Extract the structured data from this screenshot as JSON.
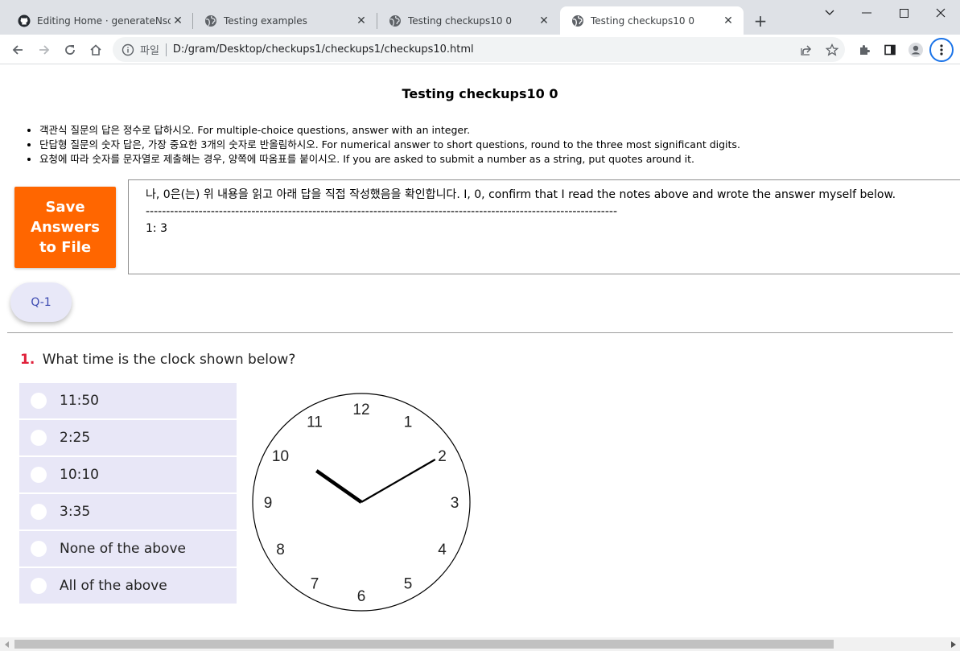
{
  "browser": {
    "tabs": [
      {
        "title": "Editing Home · generateNscor",
        "icon": "github-icon"
      },
      {
        "title": "Testing examples",
        "icon": "globe-icon"
      },
      {
        "title": "Testing checkups10 0",
        "icon": "globe-icon"
      },
      {
        "title": "Testing checkups10 0",
        "icon": "globe-icon",
        "active": true
      }
    ],
    "address": {
      "scheme_label": "파일",
      "url": "D:/gram/Desktop/checkups1/checkups1/checkups10.html"
    }
  },
  "page": {
    "title": "Testing checkups10 0",
    "notes": [
      "객관식 질문의 답은 정수로 답하시오. For multiple-choice questions, answer with an integer.",
      "단답형 질문의 숫자 답은, 가장 중요한 3개의 숫자로 반올림하시오. For numerical answer to short questions, round to the three most significant digits.",
      "요청에 따라 숫자를 문자열로 제출해는 경우, 양쪽에 따옴표를 붙이시오. If you are asked to submit a number as a string, put quotes around it."
    ],
    "save_button": "Save Answers to File",
    "answer_box": "나, 0은(는) 위 내용을 읽고 아래 답을 직접 작성했음을 확인합니다. I, 0, confirm that I read the notes above and wrote the answer myself below.\n--------------------------------------------------------------------------------------------------------------------\n1: 3",
    "nav": {
      "q1": "Q-1"
    },
    "question": {
      "number": "1.",
      "text": "What time is the clock shown below?",
      "choices": [
        "11:50",
        "2:25",
        "10:10",
        "3:35",
        "None of the above",
        "All of the above"
      ]
    },
    "clock": {
      "numbers": [
        "12",
        "1",
        "2",
        "3",
        "4",
        "5",
        "6",
        "7",
        "8",
        "9",
        "10",
        "11"
      ],
      "hour": 10,
      "minute": 10
    },
    "colors": {
      "save_button": "#ff6600",
      "choice_bg": "#e8e7f7",
      "question_number": "#e0203a"
    }
  }
}
